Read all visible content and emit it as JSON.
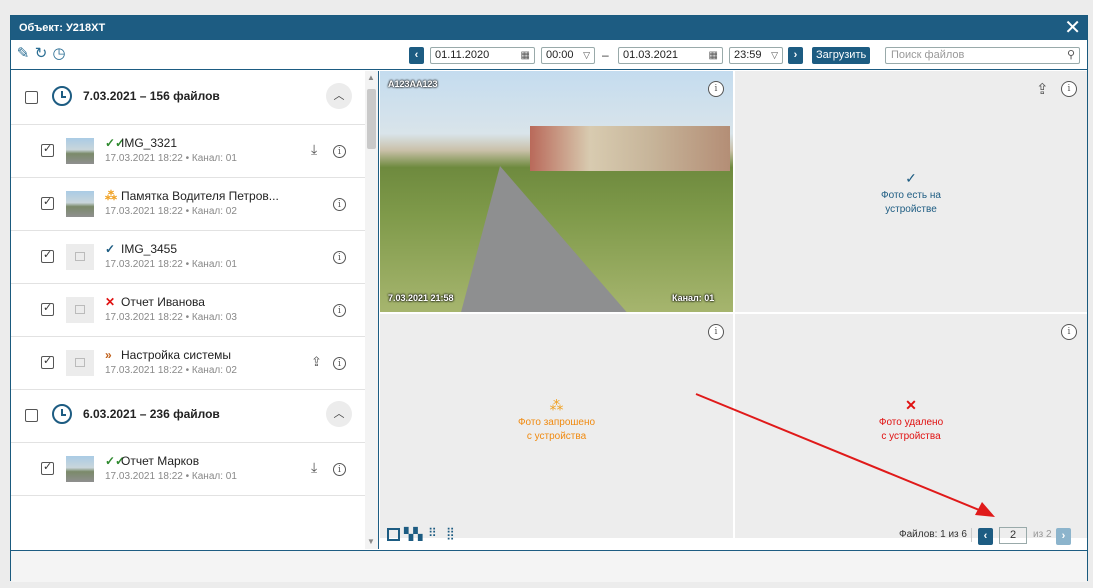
{
  "window": {
    "title": "Объект: У218ХТ",
    "close_icon": "close-icon"
  },
  "toolbar": {
    "icons": [
      "pencil-icon",
      "refresh-icon",
      "history-icon"
    ],
    "date_from": "01.11.2020",
    "time_from": "00:00",
    "dash": "–",
    "date_to": "01.03.2021",
    "time_to": "23:59",
    "load_label": "Загрузить",
    "search_placeholder": "Поиск файлов"
  },
  "groups": [
    {
      "title": "7.03.2021 – 156 файлов",
      "items": [
        {
          "name": "IMG_3321",
          "meta": "17.03.2021 18:22 • Канал: 01",
          "status": "✓✓",
          "thumb": "photo",
          "action": "download"
        },
        {
          "name": "Памятка Водителя Петров...",
          "meta": "17.03.2021 18:22 • Канал: 02",
          "status": "⁂",
          "thumb": "photo",
          "action": "none"
        },
        {
          "name": "IMG_3455",
          "meta": "17.03.2021 18:22 • Канал: 01",
          "status": "✓",
          "thumb": "placeholder",
          "action": "none"
        },
        {
          "name": "Отчет Иванова",
          "meta": "17.03.2021 18:22 • Канал: 03",
          "status": "✕",
          "thumb": "placeholder",
          "action": "none"
        },
        {
          "name": "Настройка системы",
          "meta": "17.03.2021 18:22 • Канал: 02",
          "status": "»",
          "thumb": "placeholder",
          "action": "upload"
        }
      ]
    },
    {
      "title": "6.03.2021 – 236 файлов",
      "items": [
        {
          "name": "Отчет Марков",
          "meta": "17.03.2021 18:22 • Канал: 01",
          "status": "✓✓",
          "thumb": "photo",
          "action": "download"
        }
      ]
    }
  ],
  "preview": {
    "cell1": {
      "plate": "A123AA123",
      "timestamp": "7.03.2021 21:58",
      "channel": "Канал: 01"
    },
    "cell2": {
      "mark": "✓",
      "text1": "Фото есть на",
      "text2": "устройстве"
    },
    "cell3": {
      "mark": "⁂",
      "text1": "Фото запрошено",
      "text2": "с устройства"
    },
    "cell4": {
      "mark": "✕",
      "text1": "Фото удалено",
      "text2": "с устройства"
    }
  },
  "footer": {
    "layout_icons": [
      "layout-1-icon",
      "layout-4-icon",
      "layout-9-icon",
      "layout-16-icon"
    ],
    "files_label": "Файлов: 1 из 6",
    "page_value": "2",
    "page_of": "из 2"
  },
  "colors": {
    "accent": "#1d5c82",
    "ok": "#2f8a2f",
    "pending": "#f0a020",
    "deleted": "#e01010",
    "annotation_arrow": "#e01a1a"
  }
}
